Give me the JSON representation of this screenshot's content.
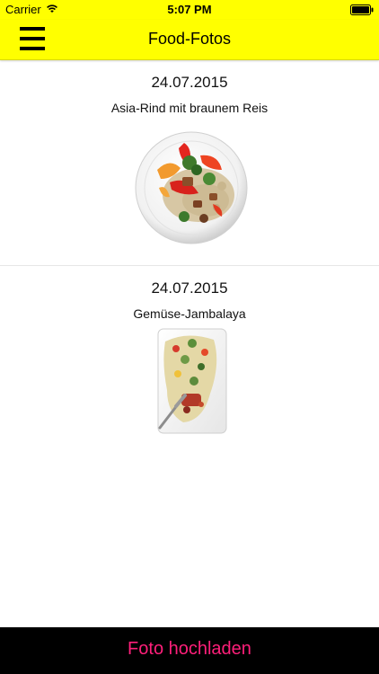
{
  "status_bar": {
    "carrier": "Carrier",
    "time": "5:07 PM",
    "wifi_icon": "wifi-icon",
    "battery_icon": "battery-icon"
  },
  "header": {
    "title": "Food-Fotos",
    "menu_icon": "hamburger-menu-icon",
    "background_color": "#ffff00"
  },
  "entries": [
    {
      "date": "24.07.2015",
      "title": "Asia-Rind mit braunem Reis",
      "image": "food-photo-round-plate"
    },
    {
      "date": "24.07.2015",
      "title": "Gemüse-Jambalaya",
      "image": "food-photo-rectangular-plate"
    }
  ],
  "footer": {
    "upload_label": "Foto hochladen",
    "accent_color": "#ff1f7a",
    "background_color": "#000000"
  }
}
